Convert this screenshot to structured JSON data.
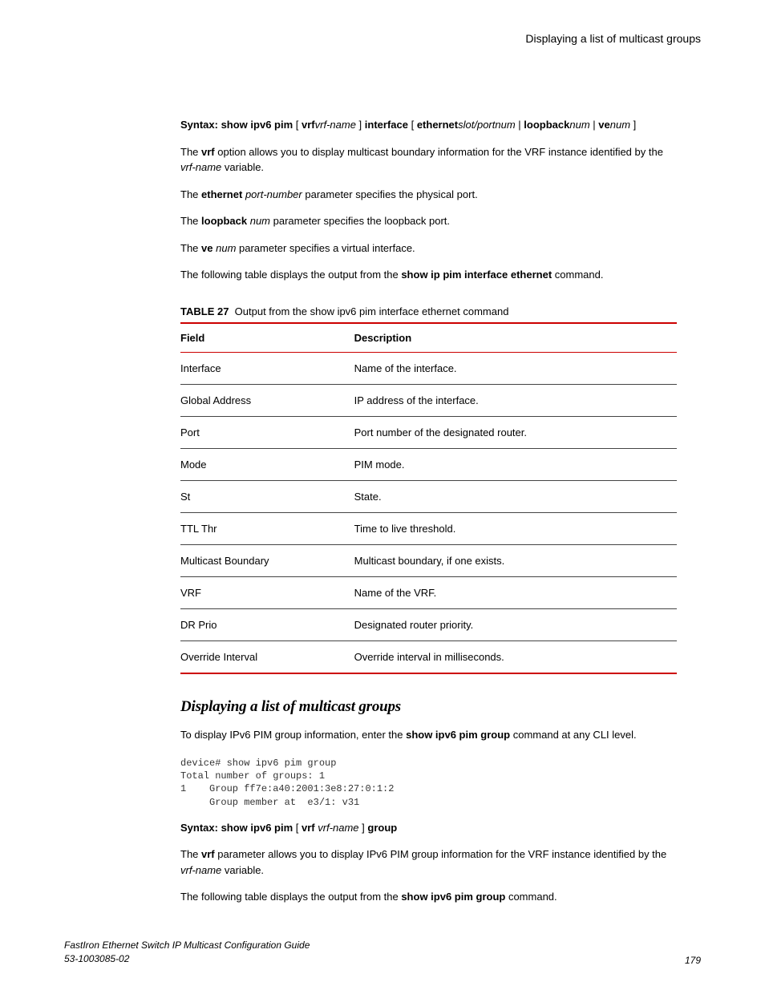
{
  "header": {
    "title": "Displaying a list of multicast groups"
  },
  "syntax1": {
    "prefix": "Syntax: show ipv6 pim",
    "vrf": "vrf",
    "vrfname": "vrf-name",
    "interface": "interface",
    "ethernet": "ethernet",
    "slotport": "slot/portnum",
    "loopback": "loopback",
    "num1": "num",
    "ve": "ve",
    "num2": "num"
  },
  "paras1": {
    "p1a": "The ",
    "p1b": "vrf",
    "p1c": " option allows you to display multicast boundary information for the VRF instance identified by the ",
    "p1d": "vrf-name",
    "p1e": " variable.",
    "p2a": "The ",
    "p2b": "ethernet",
    "p2c": " ",
    "p2d": "port-number",
    "p2e": " parameter specifies the physical port.",
    "p3a": "The ",
    "p3b": "loopback",
    "p3c": " ",
    "p3d": "num",
    "p3e": " parameter specifies the loopback port.",
    "p4a": "The ",
    "p4b": "ve",
    "p4c": " ",
    "p4d": "num",
    "p4e": " parameter specifies a virtual interface.",
    "p5a": "The following table displays the output from the ",
    "p5b": "show ip pim interface ethernet",
    "p5c": " command."
  },
  "table": {
    "caption_label": "TABLE 27",
    "caption_text": "Output from the show ipv6 pim interface ethernet command",
    "head_field": "Field",
    "head_desc": "Description",
    "rows": [
      {
        "field": "Interface",
        "desc": "Name of the interface."
      },
      {
        "field": "Global Address",
        "desc": "IP address of the interface."
      },
      {
        "field": "Port",
        "desc": "Port number of the designated router."
      },
      {
        "field": "Mode",
        "desc": "PIM mode."
      },
      {
        "field": "St",
        "desc": "State."
      },
      {
        "field": "TTL Thr",
        "desc": "Time to live threshold."
      },
      {
        "field": "Multicast Boundary",
        "desc": "Multicast boundary, if one exists."
      },
      {
        "field": "VRF",
        "desc": "Name of the VRF."
      },
      {
        "field": "DR Prio",
        "desc": "Designated router priority."
      },
      {
        "field": "Override Interval",
        "desc": "Override interval in milliseconds."
      }
    ]
  },
  "section2": {
    "heading": "Displaying a list of multicast groups",
    "intro_a": "To display IPv6 PIM group information, enter the ",
    "intro_b": "show ipv6 pim group",
    "intro_c": " command at any CLI level.",
    "cli": "device# show ipv6 pim group\nTotal number of groups: 1\n1    Group ff7e:a40:2001:3e8:27:0:1:2\n     Group member at  e3/1: v31",
    "syntax_prefix": "Syntax: show ipv6 pim",
    "syntax_vrf": "vrf",
    "syntax_vrfname": "vrf-name",
    "syntax_group": "group",
    "p1a": "The ",
    "p1b": "vrf",
    "p1c": " parameter allows you to display IPv6 PIM group information for the VRF instance identified by the ",
    "p1d": "vrf-name",
    "p1e": " variable.",
    "p2a": "The following table displays the output from the ",
    "p2b": "show ipv6 pim group",
    "p2c": " command."
  },
  "footer": {
    "guide": "FastIron Ethernet Switch IP Multicast Configuration Guide",
    "docnum": "53-1003085-02",
    "page": "179"
  }
}
